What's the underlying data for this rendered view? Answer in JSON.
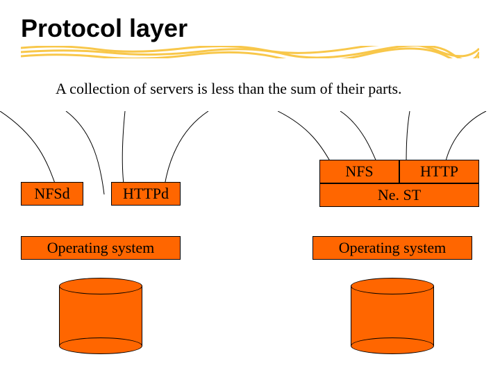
{
  "title": "Protocol layer",
  "subtitle": "A collection of servers is less than the sum of their parts.",
  "left": {
    "nfsd": "NFSd",
    "httpd": "HTTPd",
    "os": "Operating system"
  },
  "right": {
    "nfs": "NFS",
    "http": "HTTP",
    "nest": "Ne. ST",
    "os": "Operating system"
  },
  "colors": {
    "accent": "#ff6600",
    "scribble": "#f8c74a"
  }
}
